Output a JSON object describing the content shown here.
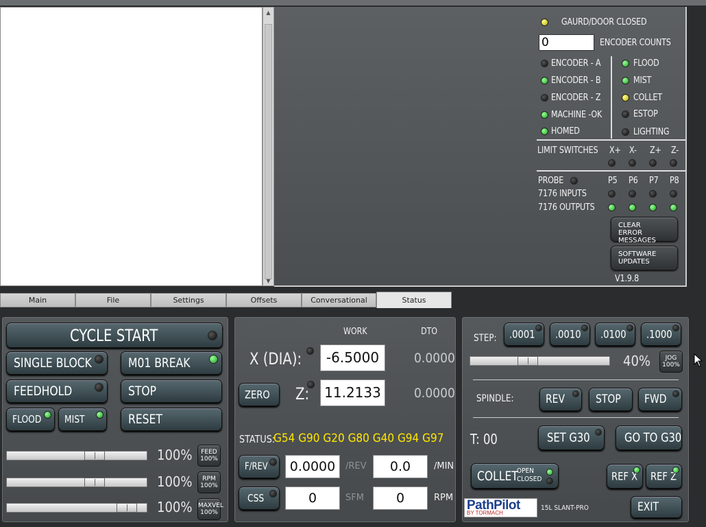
{
  "status_panel": {
    "guard_label": "GAURD/DOOR CLOSED",
    "encoder_counts_value": "0",
    "encoder_counts_label": "ENCODER COUNTS",
    "left_leds": [
      {
        "label": "ENCODER - A",
        "state": "off"
      },
      {
        "label": "ENCODER - B",
        "state": "green"
      },
      {
        "label": "ENCODER - Z",
        "state": "off"
      },
      {
        "label": "MACHINE -OK",
        "state": "green"
      },
      {
        "label": "HOMED",
        "state": "green"
      }
    ],
    "right_leds": [
      {
        "label": "FLOOD",
        "state": "green"
      },
      {
        "label": "MIST",
        "state": "green"
      },
      {
        "label": "COLLET",
        "state": "yellow"
      },
      {
        "label": "ESTOP",
        "state": "off"
      },
      {
        "label": "LIGHTING",
        "state": "off"
      }
    ],
    "limit_switches_label": "LIMIT SWITCHES",
    "limit_axes": [
      "X+",
      "X-",
      "Z+",
      "Z-"
    ],
    "probe_label": "PROBE",
    "ports": [
      "P5",
      "P6",
      "P7",
      "P8"
    ],
    "inputs_label": "7176 INPUTS",
    "outputs_label": "7176 OUTPUTS",
    "clear_errors_label": "CLEAR ERROR MESSAGES",
    "software_updates_label": "SOFTWARE UPDATES",
    "version": "V1.9.8"
  },
  "tabs": [
    "Main",
    "File",
    "Settings",
    "Offsets",
    "Conversational",
    "Status"
  ],
  "active_tab": "Status",
  "left_panel": {
    "cycle_start": "CYCLE START",
    "single_block": "SINGLE BLOCK",
    "m01_break": "M01 BREAK",
    "feedhold": "FEEDHOLD",
    "stop": "STOP",
    "flood": "FLOOD",
    "mist": "MIST",
    "reset": "RESET",
    "sliders": [
      {
        "percent": "100%",
        "btn": "FEED 100%",
        "level": 0.65
      },
      {
        "percent": "100%",
        "btn": "RPM 100%",
        "level": 0.65
      },
      {
        "percent": "100%",
        "btn": "MAXVEL 100%",
        "level": 0.92
      }
    ]
  },
  "center_panel": {
    "work_header": "WORK",
    "dto_header": "DTO",
    "x_label": "X (DIA):",
    "x_work": "-6.5000",
    "x_dto": "0.0000",
    "zero_label": "ZERO",
    "z_label": "Z:",
    "z_work": "11.2133",
    "z_dto": "0.0000",
    "status_label": "STATUS:",
    "status_codes": "G54 G90 G20 G80 G40 G94 G97",
    "frev_label": "F/REV",
    "frev_value": "0.0000",
    "frev_unit": "/REV",
    "permin_value": "0.0",
    "permin_unit": "/MIN",
    "css_label": "CSS",
    "sfm_value": "0",
    "sfm_unit": "SFM",
    "rpm_value": "0",
    "rpm_unit": "RPM"
  },
  "right_panel": {
    "step_label": "STEP:",
    "steps": [
      ".0001",
      ".0010",
      ".0100",
      ".1000"
    ],
    "jog_percent": "40%",
    "jog_level": 0.4,
    "jog_btn": "JOG 100%",
    "spindle_label": "SPINDLE:",
    "rev": "REV",
    "stop": "STOP",
    "fwd": "FWD",
    "tool_label": "T: 00",
    "set_g30": "SET G30",
    "go_to_g30": "GO TO G30",
    "collet": "COLLET",
    "collet_open": "OPEN",
    "collet_closed": "CLOSED",
    "ref_x": "REF X",
    "ref_z": "REF Z",
    "logo_main": "PathPilot",
    "logo_sub": "BY TORMACH",
    "machine": "15L SLANT-PRO",
    "exit": "EXIT"
  },
  "colors": {
    "status_codes": "#ffe600",
    "led_green": "#2bd12b",
    "led_yellow": "#e3d400"
  }
}
